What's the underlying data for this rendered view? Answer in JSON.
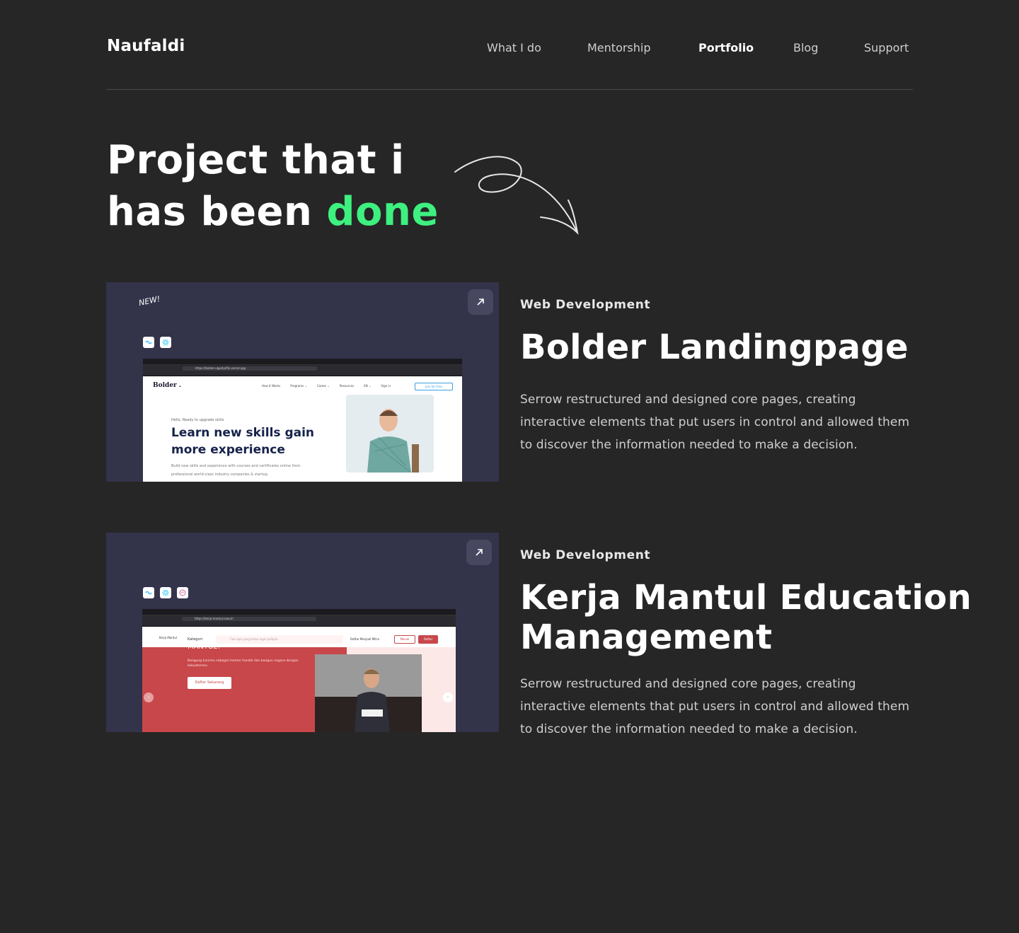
{
  "header": {
    "logo": "Naufaldi",
    "nav": [
      {
        "label": "What I do",
        "active": false
      },
      {
        "label": "Mentorship",
        "active": false
      },
      {
        "label": "Portfolio",
        "active": true
      },
      {
        "label": "Blog",
        "active": false
      },
      {
        "label": "Support",
        "active": false
      }
    ]
  },
  "hero": {
    "line1": "Project that i",
    "line2_prefix": "has been ",
    "line2_accent": "done",
    "accent_color": "#3ef07f"
  },
  "projects": [
    {
      "category": "Web Development",
      "title": "Bolder Landingpage",
      "description": "Serrow restructured and designed core pages, creating interactive elements that put users in control and allowed them to discover the information needed to make a decision.",
      "badge": "NEW!",
      "screenshot": {
        "url": "https://bolder-ulgo4y45k.vercel.app",
        "brand": "Bolder .",
        "links": [
          "How It Works",
          "Programs ⌄",
          "Career ⌄",
          "Resources",
          "EN ⌄",
          "Sign in"
        ],
        "cta": "Join for Free",
        "eyebrow": "Hello, Ready to upgrade skills",
        "headline": "Learn new skills gain more experience",
        "subtext": "Build new skills and experience with courses and certificates online from professional world-class industry companies & startup."
      }
    },
    {
      "category": "Web Development",
      "title": "Kerja Mantul Education Management",
      "description": "Serrow restructured and designed core pages, creating interactive elements that put users in control and allowed them to discover the information needed to make a decision.",
      "screenshot": {
        "url": "https://kerja-mantul.now.sh",
        "brand": "Kerja Mantul",
        "kategori": "Kategori",
        "search_placeholder": "Cari apa yang kamu ingin pelajari",
        "mitra": "Daftar Menjadi Mitra",
        "login": "Masuk",
        "register": "Daftar",
        "headline": "MAU JADI MITRA KERJA MANTUL?",
        "subtext": "Bangung karirmu sebagai mentor handal dan bangun negara dengan kekuatanmu",
        "cta": "Daftar Sekarang"
      }
    }
  ]
}
